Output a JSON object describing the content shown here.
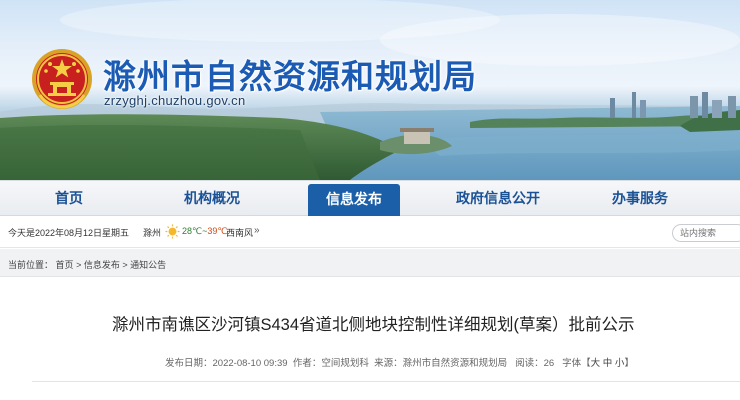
{
  "header": {
    "site_title": "滁州市自然资源和规划局",
    "domain": "zrzyghj.chuzhou.gov.cn",
    "emblem_icon": "national-emblem",
    "title_color": "#1b5bb3"
  },
  "nav": {
    "items": [
      {
        "label": "首页",
        "active": false
      },
      {
        "label": "机构概况",
        "active": false
      },
      {
        "label": "信息发布",
        "active": true
      },
      {
        "label": "政府信息公开",
        "active": false
      },
      {
        "label": "办事服务",
        "active": false
      }
    ],
    "active_color": "#1a5fa8"
  },
  "infobar": {
    "date_text": "今天是2022年08月12日",
    "weekday": "星期五",
    "city": "滁州",
    "weather_icon": "sun-icon",
    "temp_low": "28℃",
    "temp_sep": "~",
    "temp_high": "39℃",
    "wind": "西南风",
    "more_icon": "double-chevron-right-icon",
    "search_placeholder": "站内搜索"
  },
  "breadcrumb": {
    "prefix": "当前位置：",
    "items": [
      "首页",
      "信息发布",
      "通知公告"
    ],
    "separator": ">"
  },
  "article": {
    "title": "滁州市南谯区沙河镇S434省道北侧地块控制性详细规划(草案）批前公示",
    "meta": {
      "date_label": "发布日期：",
      "date": "2022-08-10 09:39",
      "author_label": "作者：",
      "author": "空间规划科",
      "source_label": "来源：",
      "source": "滁州市自然资源和规划局",
      "reads_label": "阅读：",
      "reads": "26",
      "font_label": "字体【",
      "font_large": "大",
      "font_medium": "中",
      "font_small": "小",
      "font_close": "】"
    }
  }
}
